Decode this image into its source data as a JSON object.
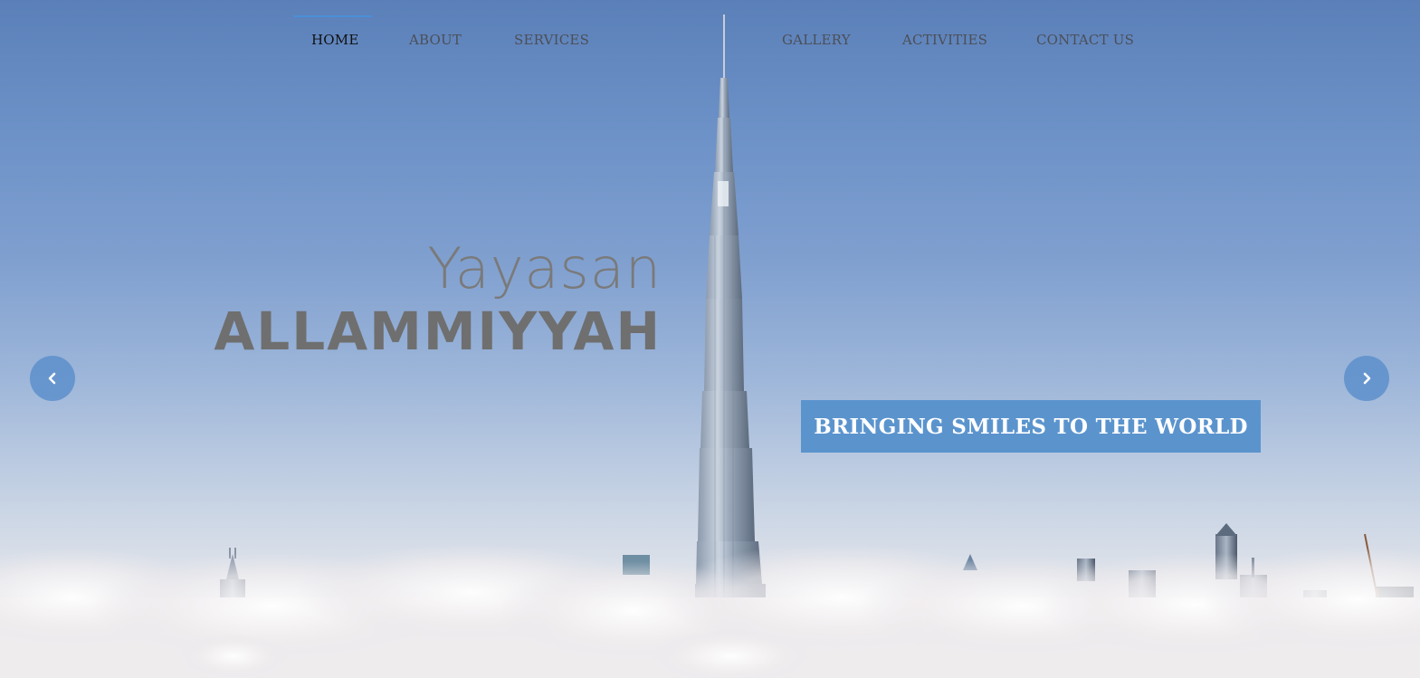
{
  "nav": {
    "items": [
      {
        "label": "HOME",
        "active": true
      },
      {
        "label": "ABOUT",
        "active": false
      },
      {
        "label": "SERVICES",
        "active": false
      },
      {
        "label": "GALLERY",
        "active": false
      },
      {
        "label": "ACTIVITIES",
        "active": false
      },
      {
        "label": "CONTACT US",
        "active": false
      }
    ]
  },
  "hero": {
    "brand_line1": "Yayasan",
    "brand_line2": "ALLAMMIYYAH",
    "tagline": "BRINGING SMILES TO THE WORLD",
    "prev_icon": "chevron-left-icon",
    "next_icon": "chevron-right-icon"
  },
  "colors": {
    "accent": "#5b94cd",
    "nav_indicator": "#4a8fd8",
    "nav_text": "#4b4f57",
    "brand_text": "#6f6f6f"
  }
}
